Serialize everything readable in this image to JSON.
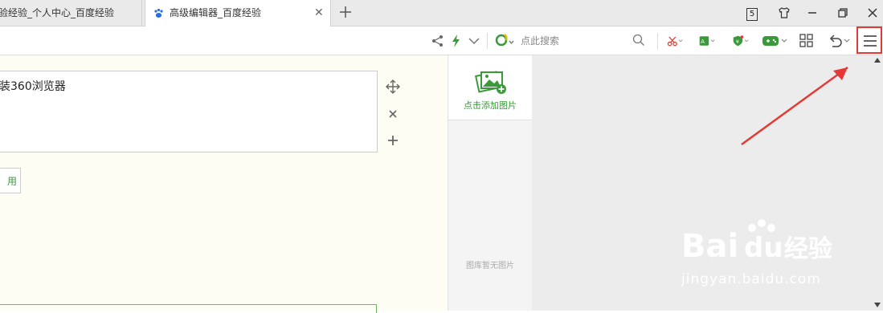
{
  "tabs": [
    {
      "label": "验经验_个人中心_百度经验"
    },
    {
      "label": "高级编辑器_百度经验",
      "close": "✕"
    }
  ],
  "window": {
    "badge": "5"
  },
  "search": {
    "placeholder": "点此搜索"
  },
  "editor": {
    "text": "装360浏览器",
    "button_fragment": "用"
  },
  "gallery": {
    "add_label": "点击添加图片",
    "empty_label": "图库暂无图片"
  },
  "watermark": {
    "url": "jingyan.baidu.com",
    "brand": "Bai du 经验"
  },
  "colors": {
    "accent_green": "#3a9a3a",
    "annotation_red": "#e53935"
  },
  "icons": [
    "share-icon",
    "lightning-icon",
    "chevron-down-icon",
    "search-engine-icon",
    "search-icon",
    "scissors-icon",
    "translate-icon",
    "shield-icon",
    "gamepad-icon",
    "apps-grid-icon",
    "undo-icon",
    "menu-icon"
  ]
}
